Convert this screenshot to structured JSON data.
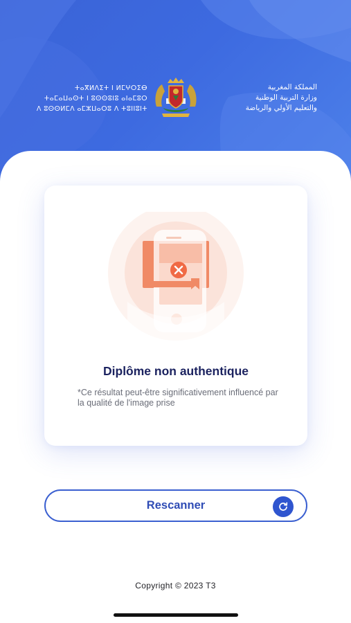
{
  "header": {
    "tifinagh_lines": [
      "ⵜⴰⴳⵍⴷⵉⵜ ⵏ ⵍⵎⵖⵔⵉⴱ",
      "ⵜⴰⵎⴰⵡⴰⵙⵜ ⵏ ⵓⵙⵙⵓⵏⵓ ⴰⵏⴰⵎⵓⵔ",
      "ⴷ ⵓⵙⵙⵍⵎⴷ ⴰⵎⵣⵡⴰⵔⵓ ⴷ ⵜⵓⵏⵏⵓⵏⵜ"
    ],
    "arabic_lines": [
      "المملكة المغربية",
      "وزارة التربية الوطنية",
      "والتعليم الأولي والرياضة"
    ],
    "emblem_icon": "coat-of-arms-icon"
  },
  "result": {
    "illustration_icon": "phone-invalid-diploma-icon",
    "title": "Diplôme non authentique",
    "note": "*Ce résultat peut-être significativement influencé par la qualité de l'image prise"
  },
  "rescan_button": {
    "label": "Rescanner",
    "icon": "refresh-icon"
  },
  "footer": {
    "copyright": "Copyright © 2023 T3"
  },
  "colors": {
    "header_blue": "#3d6ae0",
    "title_navy": "#1c2360",
    "button_blue": "#2f55cf",
    "error_orange": "#f06a45"
  }
}
